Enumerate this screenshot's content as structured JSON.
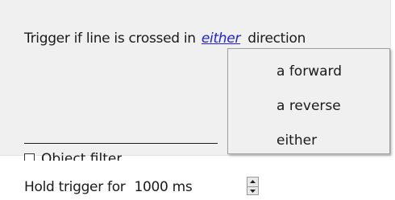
{
  "trigger": {
    "prefix": "Trigger if line is crossed in",
    "link": "either",
    "suffix": "direction"
  },
  "dropdown": {
    "items": [
      "a forward",
      "a reverse",
      "either"
    ]
  },
  "object_filter": {
    "label": "Object filter",
    "checked": false
  },
  "hold": {
    "label": "Hold trigger for",
    "value": "1000 ms"
  }
}
